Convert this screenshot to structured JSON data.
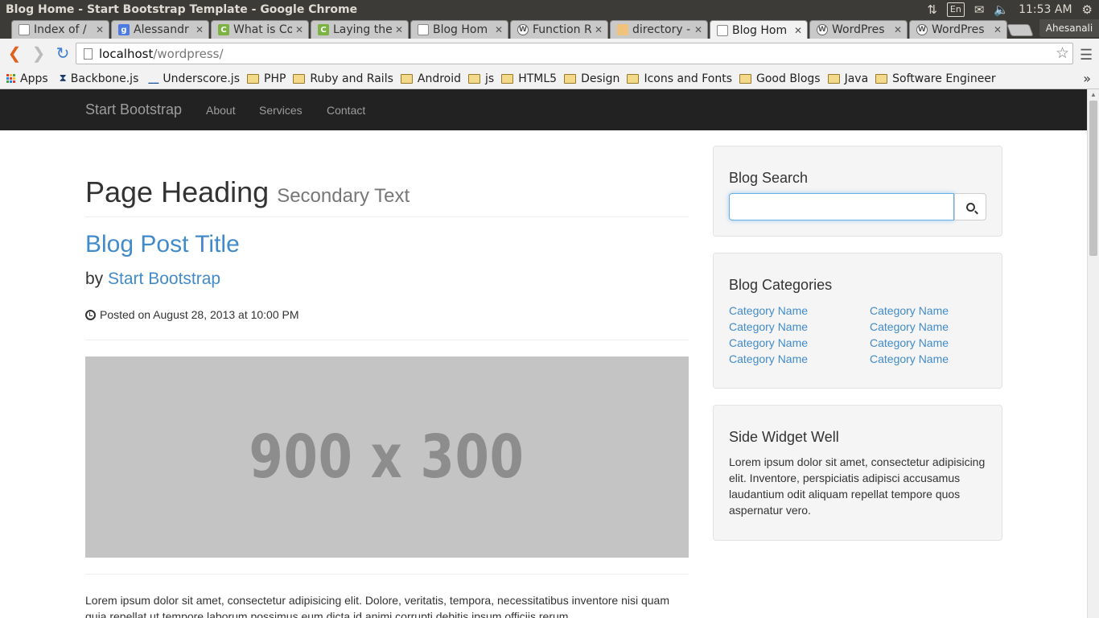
{
  "os": {
    "window_title": "Blog Home - Start Bootstrap Template - Google Chrome",
    "keyboard_layout": "En",
    "clock": "11:53 AM",
    "icons": [
      "network-icon",
      "keyboard-icon",
      "mail-icon",
      "volume-icon",
      "settings-gear-icon"
    ]
  },
  "browser": {
    "tabs": [
      {
        "label": "Index of /",
        "favicon": "doc"
      },
      {
        "label": "Alessandr",
        "favicon": "google"
      },
      {
        "label": "What is Co",
        "favicon": "c"
      },
      {
        "label": "Laying the",
        "favicon": "c"
      },
      {
        "label": "Blog Hom",
        "favicon": "doc"
      },
      {
        "label": "Function R",
        "favicon": "wordpress"
      },
      {
        "label": "directory -",
        "favicon": "dir"
      },
      {
        "label": "Blog Hom",
        "favicon": "doc",
        "active": true
      },
      {
        "label": "WordPres",
        "favicon": "wordpress"
      },
      {
        "label": "WordPres",
        "favicon": "wordpress"
      }
    ],
    "profile_name": "Ahesanali",
    "url_host": "localhost",
    "url_path": "/wordpress/",
    "bookmarks": [
      {
        "label": "Apps",
        "type": "apps"
      },
      {
        "label": "Backbone.js",
        "type": "link"
      },
      {
        "label": "Underscore.js",
        "type": "link"
      },
      {
        "label": "PHP",
        "type": "folder"
      },
      {
        "label": "Ruby and Rails",
        "type": "folder"
      },
      {
        "label": "Android",
        "type": "folder"
      },
      {
        "label": "js",
        "type": "folder"
      },
      {
        "label": "HTML5",
        "type": "folder"
      },
      {
        "label": "Design",
        "type": "folder"
      },
      {
        "label": "Icons and Fonts",
        "type": "folder"
      },
      {
        "label": "Good Blogs",
        "type": "folder"
      },
      {
        "label": "Java",
        "type": "folder"
      },
      {
        "label": "Software Engineer",
        "type": "folder"
      }
    ],
    "more_bookmarks": "»"
  },
  "page": {
    "brand": "Start Bootstrap",
    "nav": [
      "About",
      "Services",
      "Contact"
    ],
    "heading": "Page Heading",
    "heading_secondary": "Secondary Text",
    "post_title": "Blog Post Title",
    "by_prefix": "by",
    "author": "Start Bootstrap",
    "posted": "Posted on August 28, 2013 at 10:00 PM",
    "placeholder_text": "900 x 300",
    "lorem": "Lorem ipsum dolor sit amet, consectetur adipisicing elit. Dolore, veritatis, tempora, necessitatibus inventore nisi quam quia repellat ut tempore laborum possimus eum dicta id animi corrupti debitis ipsum officiis rerum."
  },
  "sidebar": {
    "search_title": "Blog Search",
    "search_value": "",
    "categories_title": "Blog Categories",
    "categories_left": [
      "Category Name",
      "Category Name",
      "Category Name",
      "Category Name"
    ],
    "categories_right": [
      "Category Name",
      "Category Name",
      "Category Name",
      "Category Name"
    ],
    "widget_title": "Side Widget Well",
    "widget_text": "Lorem ipsum dolor sit amet, consectetur adipisicing elit. Inventore, perspiciatis adipisci accusamus laudantium odit aliquam repellat tempore quos aspernatur vero."
  },
  "colors": {
    "link": "#428bca",
    "navbar_bg": "#222222",
    "well_bg": "#f5f5f5",
    "placeholder_bg": "#c4c4c4"
  }
}
